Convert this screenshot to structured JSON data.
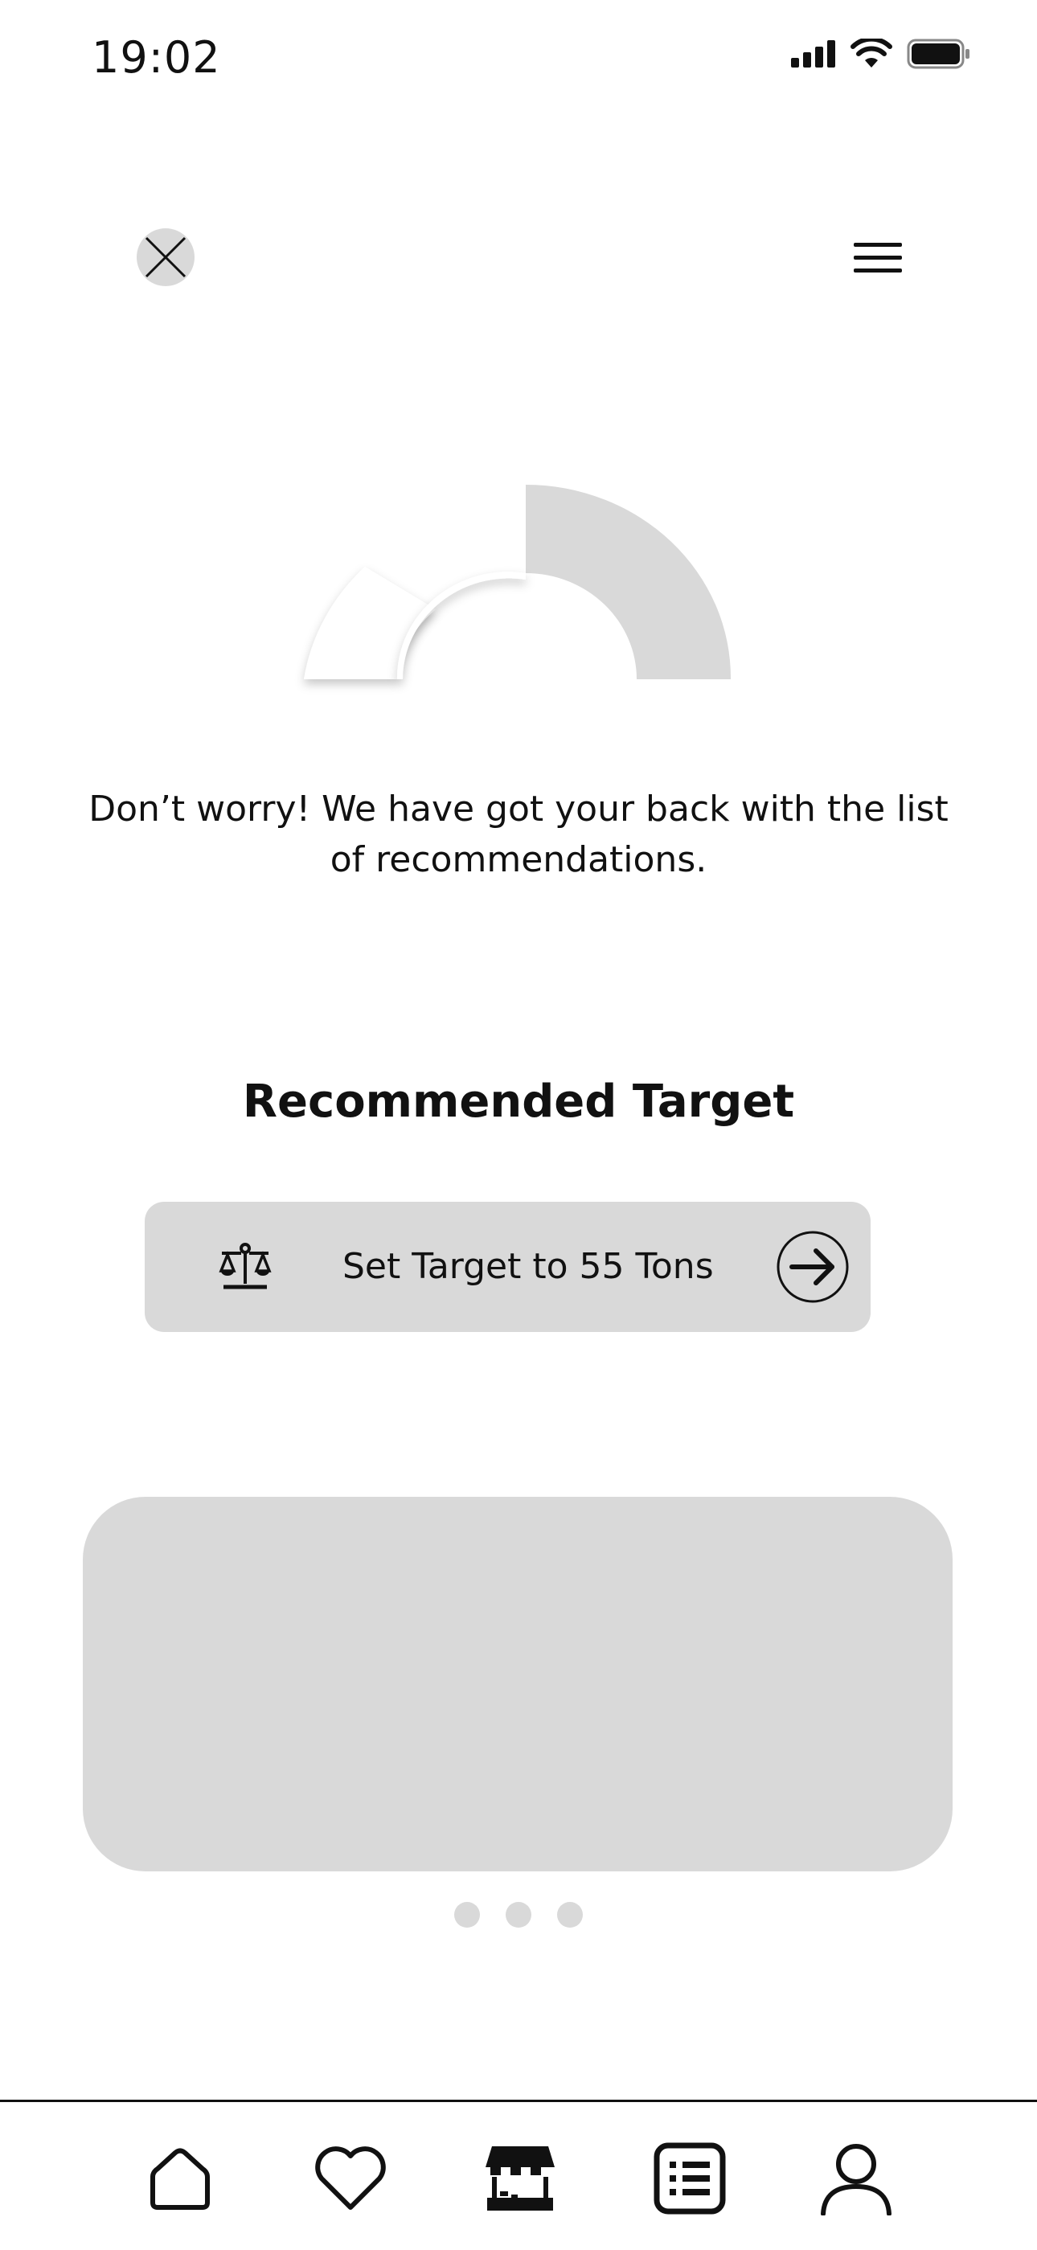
{
  "status_bar": {
    "time": "19:02",
    "icons": [
      "cellular-signal-icon",
      "wifi-icon",
      "battery-icon"
    ]
  },
  "top_bar": {
    "close_icon": "close-icon",
    "menu_icon": "hamburger-menu-icon"
  },
  "gauge": {
    "segments": [
      "white-segment",
      "grey-segment"
    ]
  },
  "message": "Don’t worry! We have got your back with the list of recommendations.",
  "recommended": {
    "title": "Recommended Target",
    "button_label": "Set Target to 55 Tons",
    "button_icon": "scale-balance-icon",
    "arrow_icon": "arrow-right-circle-icon"
  },
  "carousel": {
    "page_count": 3,
    "active_page": 1
  },
  "tab_bar": {
    "tabs": [
      {
        "name": "home",
        "icon": "home-icon"
      },
      {
        "name": "favorites",
        "icon": "heart-icon"
      },
      {
        "name": "store",
        "icon": "store-icon"
      },
      {
        "name": "list",
        "icon": "list-icon"
      },
      {
        "name": "profile",
        "icon": "user-icon"
      }
    ]
  },
  "colors": {
    "placeholder_grey": "#d9d9d9",
    "text": "#111111",
    "background": "#ffffff"
  }
}
